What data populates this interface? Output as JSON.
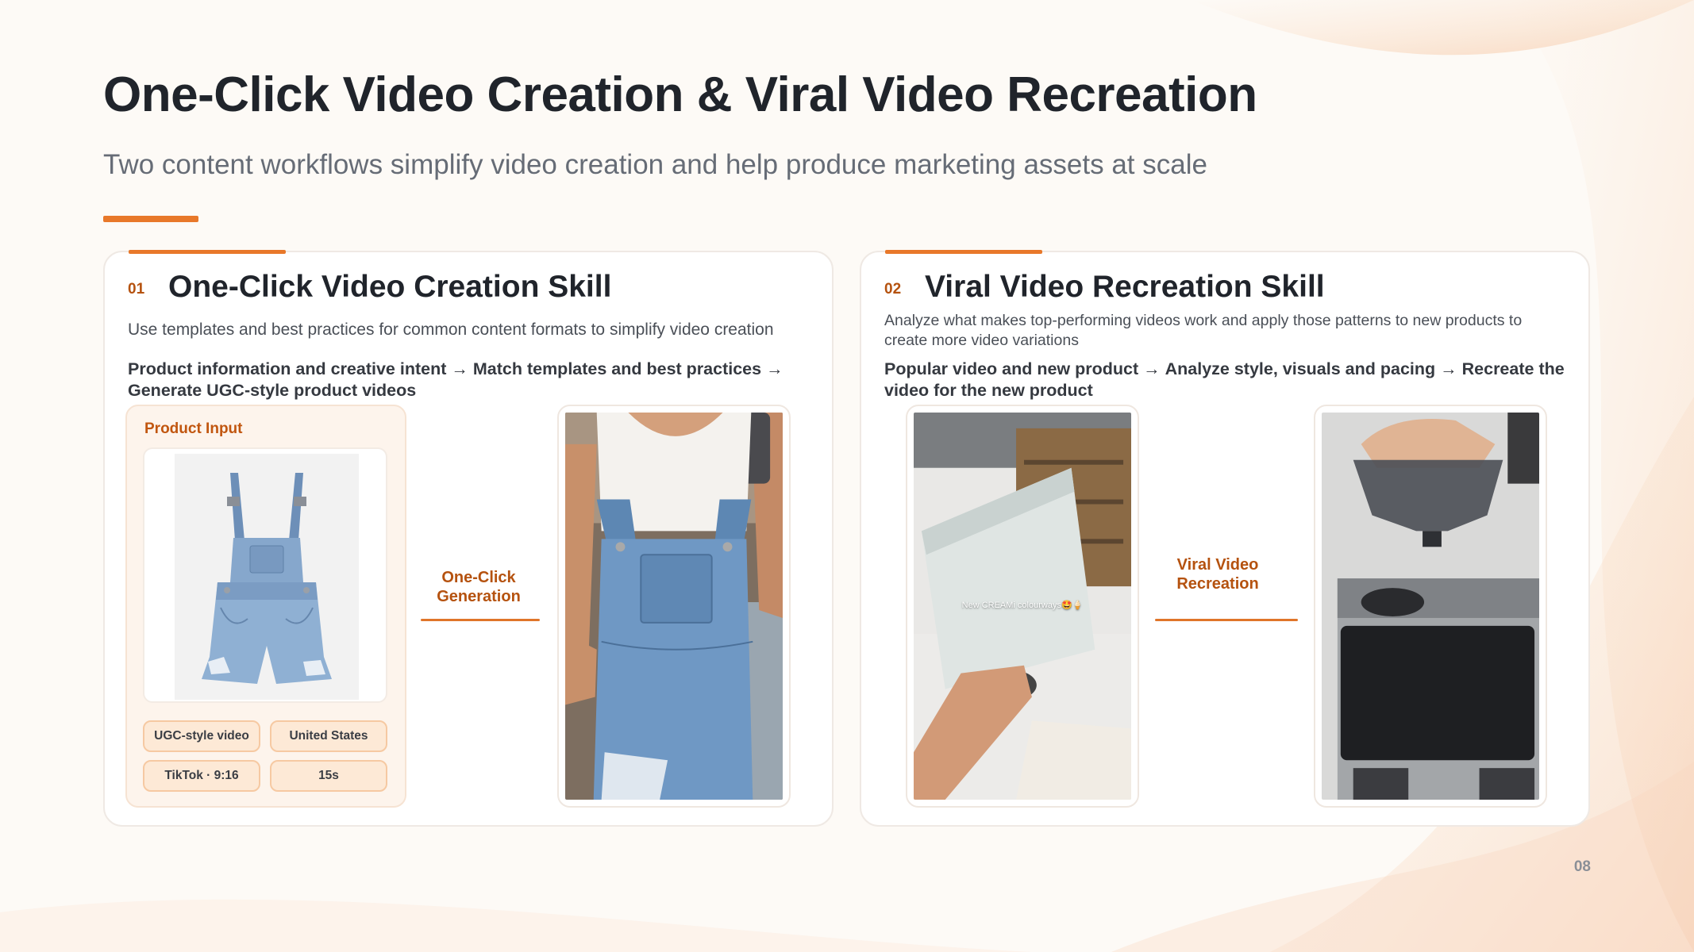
{
  "slide": {
    "title": "One-Click Video Creation & Viral Video Recreation",
    "subtitle": "Two content workflows simplify video creation and help produce marketing assets at scale",
    "page_number": "08",
    "accent_color": "#e8782a"
  },
  "left_card": {
    "number": "01",
    "heading": "One-Click Video Creation Skill",
    "description": "Use templates and best practices for common content formats to simplify video creation",
    "flow": {
      "step1": "Product information and creative intent",
      "step2": "Match templates and best practices",
      "step3": "Generate UGC-style product videos",
      "arrow": "→"
    },
    "input_panel": {
      "label": "Product Input",
      "product_image": "denim-overall-shorts-image",
      "chips": [
        "UGC-style video",
        "United States",
        "TikTok · 9:16",
        "15s"
      ]
    },
    "connector": {
      "line1": "One-Click",
      "line2": "Generation"
    },
    "output_video": "woman-wearing-denim-overalls-video"
  },
  "right_card": {
    "number": "02",
    "heading": "Viral Video Recreation Skill",
    "description": "Analyze what makes top-performing videos work and apply those patterns to new products to create more video variations",
    "flow": {
      "step1": "Popular video and new product",
      "step2": "Analyze style, visuals and pacing",
      "step3": "Recreate the video for the new product",
      "arrow": "→"
    },
    "source_video": {
      "image": "hand-holding-product-pouch-video",
      "caption": "New CREAMi colourways🤩🍦"
    },
    "connector": {
      "line1": "Viral Video",
      "line2": "Recreation"
    },
    "output_video": "hand-lifting-grinder-lid-video"
  }
}
